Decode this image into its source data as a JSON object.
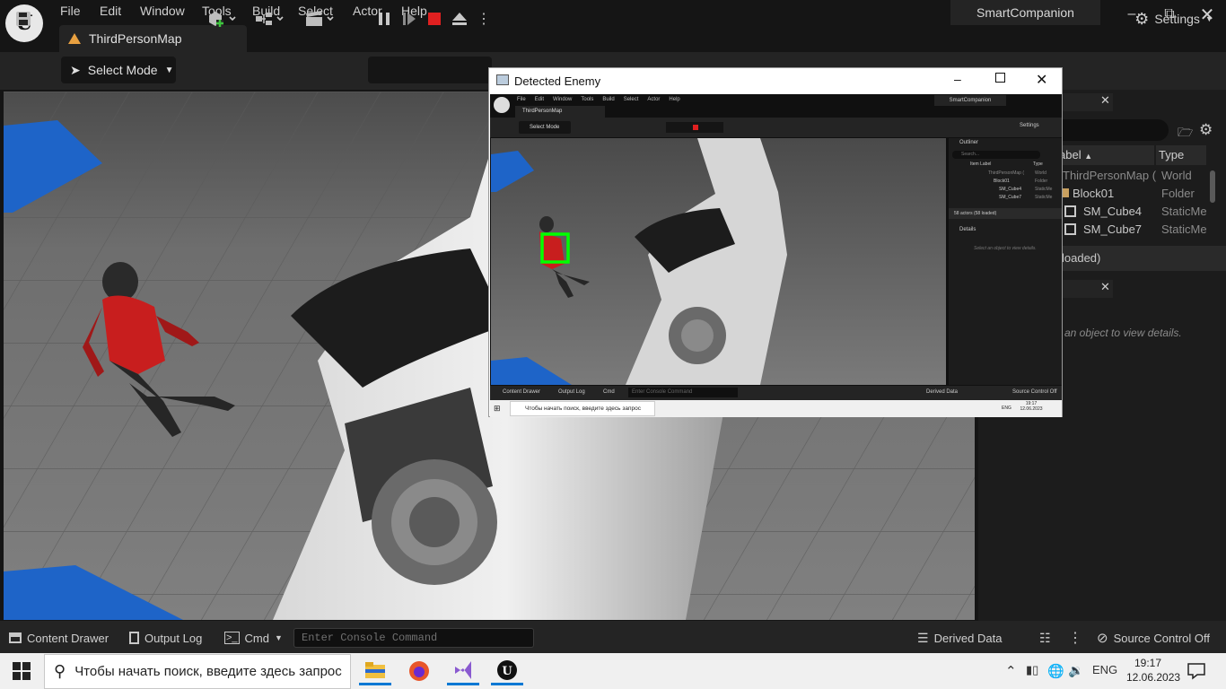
{
  "menu": {
    "items": [
      "File",
      "Edit",
      "Window",
      "Tools",
      "Build",
      "Select",
      "Actor",
      "Help"
    ]
  },
  "project_name": "SmartCompanion",
  "map_tab": {
    "label": "ThirdPersonMap"
  },
  "toolbar": {
    "select_mode": "Select Mode",
    "settings": "Settings"
  },
  "outliner": {
    "columns": {
      "label": "abel",
      "type": "Type"
    },
    "rows": [
      {
        "label": "ThirdPersonMap (",
        "type": "World"
      },
      {
        "label": "Block01",
        "type": "Folder"
      },
      {
        "label": "SM_Cube4",
        "type": "StaticMe"
      },
      {
        "label": "SM_Cube7",
        "type": "StaticMe"
      }
    ],
    "status": "loaded)"
  },
  "details": {
    "hint": "an object to view details."
  },
  "detected_window": {
    "title": "Detected Enemy",
    "inner": {
      "menu": [
        "File",
        "Edit",
        "Window",
        "Tools",
        "Build",
        "Select",
        "Actor",
        "Help"
      ],
      "project": "SmartCompanion",
      "map_tab": "ThirdPersonMap",
      "select_mode": "Select Mode",
      "settings": "Settings",
      "outliner_title": "Outliner",
      "search_placeholder": "Search...",
      "item_label": "Item Label",
      "type_col": "Type",
      "rows": [
        {
          "label": "ThirdPersonMap (",
          "type": "World"
        },
        {
          "label": "Block01",
          "type": "Folder"
        },
        {
          "label": "SM_Cube4",
          "type": "StaticMe"
        },
        {
          "label": "SM_Cube7",
          "type": "StaticMe"
        }
      ],
      "actors_status": "58 actors (58 loaded)",
      "details_title": "Details",
      "details_hint": "Select an object to view details.",
      "content_drawer": "Content Drawer",
      "output_log": "Output Log",
      "cmd": "Cmd",
      "console_placeholder": "Enter Console Command",
      "derived_data": "Derived Data",
      "source_control": "Source Control Off",
      "search_text": "Чтобы начать поиск, введите здесь запрос",
      "lang": "ENG",
      "time": "19:17",
      "date": "12.06.2023"
    }
  },
  "bottom": {
    "content_drawer": "Content Drawer",
    "output_log": "Output Log",
    "cmd": "Cmd",
    "console_placeholder": "Enter Console Command",
    "derived_data": "Derived Data",
    "source_control": "Source Control Off"
  },
  "taskbar": {
    "search_text": "Чтобы начать поиск, введите здесь запрос",
    "lang": "ENG",
    "time": "19:17",
    "date": "12.06.2023"
  },
  "colors": {
    "accent": "#0078d4",
    "detection_box": "#00ff00",
    "blue_block": "#1e64c8",
    "stop_red": "#e02020"
  }
}
